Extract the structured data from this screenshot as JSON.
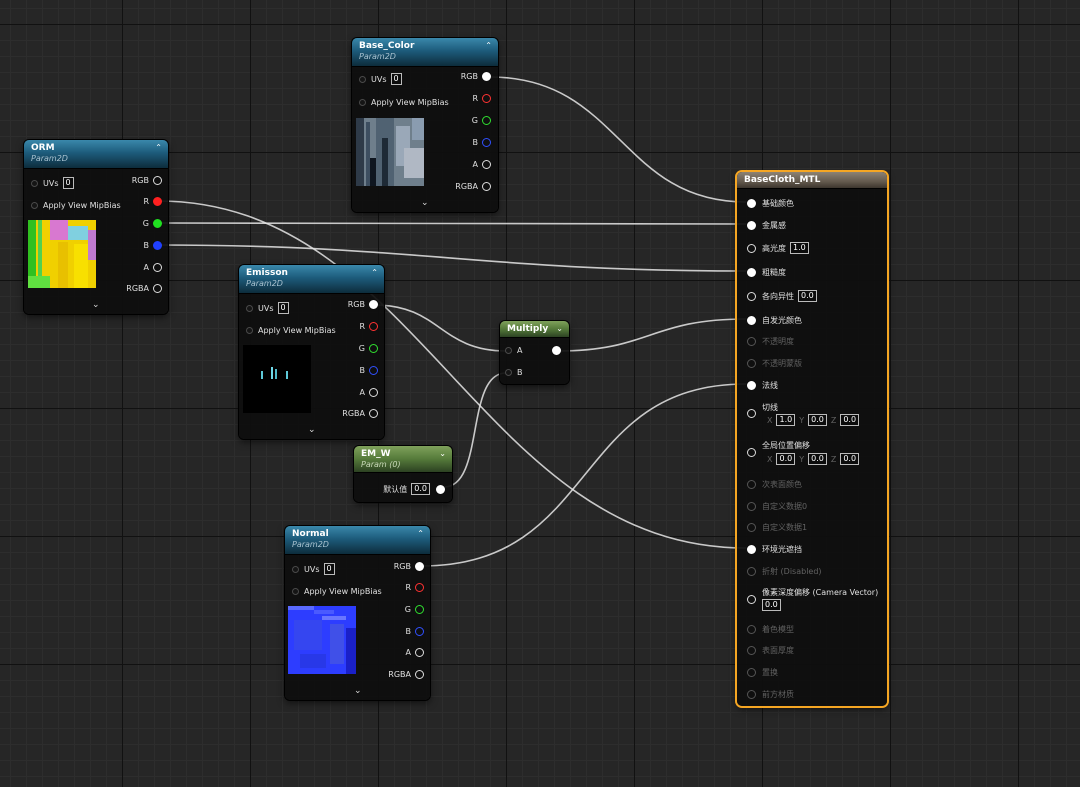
{
  "nodes": {
    "base_color": {
      "title": "Base_Color",
      "subtitle": "Param2D",
      "inputs": [
        "UVs",
        "Apply View MipBias"
      ],
      "uv_value": "0",
      "outputs": [
        "RGB",
        "R",
        "G",
        "B",
        "A",
        "RGBA"
      ]
    },
    "orm": {
      "title": "ORM",
      "subtitle": "Param2D",
      "inputs": [
        "UVs",
        "Apply View MipBias"
      ],
      "uv_value": "0",
      "outputs": [
        "RGB",
        "R",
        "G",
        "B",
        "A",
        "RGBA"
      ]
    },
    "emisson": {
      "title": "Emisson",
      "subtitle": "Param2D",
      "inputs": [
        "UVs",
        "Apply View MipBias"
      ],
      "uv_value": "0",
      "outputs": [
        "RGB",
        "R",
        "G",
        "B",
        "A",
        "RGBA"
      ]
    },
    "multiply": {
      "title": "Multiply",
      "inputs": [
        "A",
        "B"
      ]
    },
    "em_w": {
      "title": "EM_W",
      "subtitle": "Param (0)",
      "label": "默认值",
      "value": "0.0"
    },
    "normal": {
      "title": "Normal",
      "subtitle": "Param2D",
      "inputs": [
        "UVs",
        "Apply View MipBias"
      ],
      "uv_value": "0",
      "outputs": [
        "RGB",
        "R",
        "G",
        "B",
        "A",
        "RGBA"
      ]
    },
    "material": {
      "title": "BaseCloth_MTL",
      "pins": [
        {
          "label": "基础颜色",
          "active": true
        },
        {
          "label": "金属感",
          "active": true
        },
        {
          "label": "高光度",
          "active": true,
          "value": "1.0"
        },
        {
          "label": "粗糙度",
          "active": true
        },
        {
          "label": "各向异性",
          "active": true,
          "value": "0.0"
        },
        {
          "label": "自发光颜色",
          "active": true
        },
        {
          "label": "不透明度",
          "active": false
        },
        {
          "label": "不透明蒙版",
          "active": false
        },
        {
          "label": "法线",
          "active": true
        },
        {
          "label": "切线",
          "active": true,
          "xyz": [
            "1.0",
            "0.0",
            "0.0"
          ]
        },
        {
          "label": "全局位置偏移",
          "active": true,
          "xyz": [
            "0.0",
            "0.0",
            "0.0"
          ]
        },
        {
          "label": "次表面颜色",
          "active": false
        },
        {
          "label": "自定义数据0",
          "active": false
        },
        {
          "label": "自定义数据1",
          "active": false
        },
        {
          "label": "环境光遮挡",
          "active": true
        },
        {
          "label": "折射 (Disabled)",
          "active": false
        },
        {
          "label": "像素深度偏移 (Camera Vector)",
          "active": true,
          "value": "0.0"
        },
        {
          "label": "着色模型",
          "active": false
        },
        {
          "label": "表面厚度",
          "active": false
        },
        {
          "label": "置换",
          "active": false
        },
        {
          "label": "前方材质",
          "active": false
        }
      ],
      "axis_labels": [
        "X",
        "Y",
        "Z"
      ]
    }
  },
  "colors": {
    "selection": "#f5a623",
    "texture_header": "#1d5c7c",
    "param_header": "#557a3a",
    "material_header": "#645a4e",
    "wire": "#e6e6e6"
  }
}
